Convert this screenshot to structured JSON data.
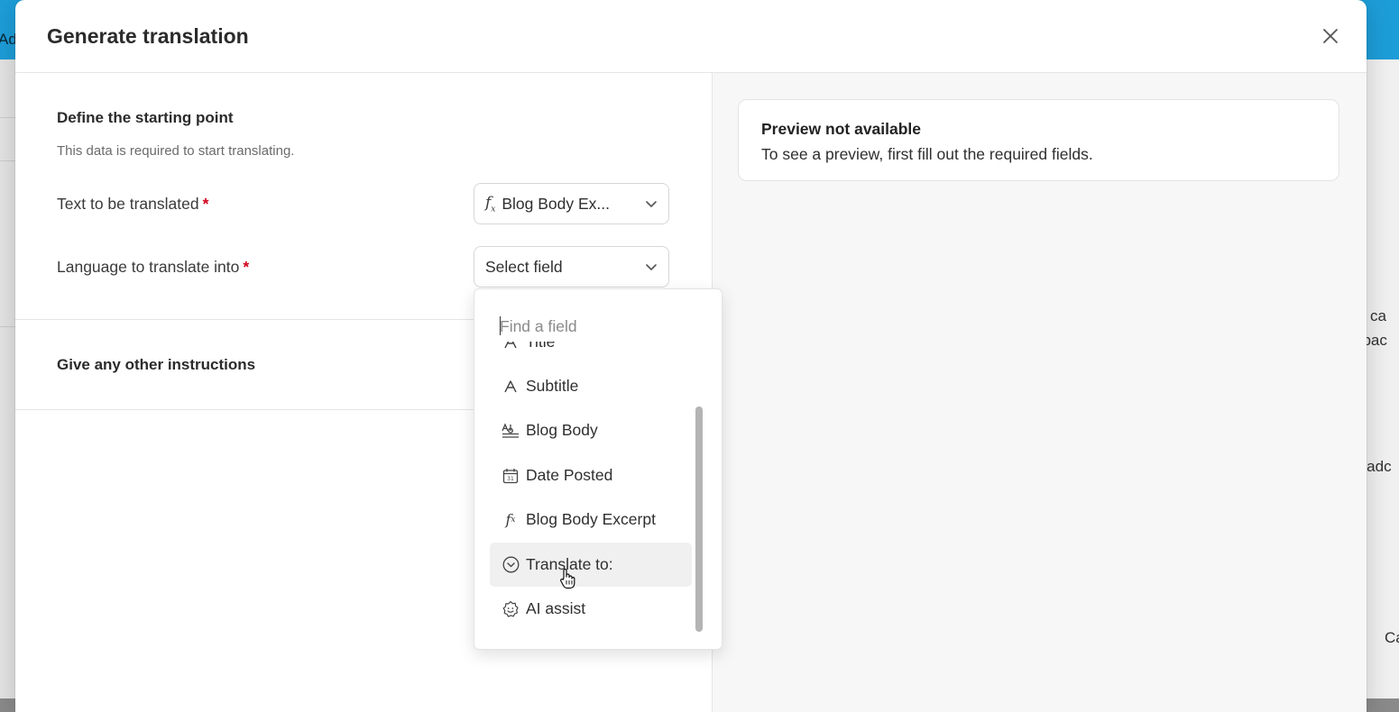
{
  "background": {
    "app_fragment": "Ad",
    "right_fragments": [
      "s, ca",
      "dbac",
      "n adc",
      "Ca"
    ]
  },
  "modal": {
    "title": "Generate translation",
    "close_icon": "close-icon"
  },
  "left": {
    "starting_point_title": "Define the starting point",
    "starting_point_subtitle": "This data is required to start translating.",
    "text_field_label": "Text to be translated",
    "text_field_value": "Blog Body Ex...",
    "text_field_icon": "formula-icon",
    "language_field_label": "Language to translate into",
    "language_field_value": "Select field",
    "required_mark": "*",
    "instructions_title": "Give any other instructions"
  },
  "preview": {
    "title": "Preview not available",
    "text": "To see a preview, first fill out the required fields."
  },
  "dropdown": {
    "search_placeholder": "Find a field",
    "options": [
      {
        "label": "Title",
        "icon": "single-line-text-icon"
      },
      {
        "label": "Subtitle",
        "icon": "single-line-text-icon"
      },
      {
        "label": "Blog Body",
        "icon": "long-text-icon"
      },
      {
        "label": "Date Posted",
        "icon": "calendar-icon"
      },
      {
        "label": "Blog Body Excerpt",
        "icon": "formula-icon"
      },
      {
        "label": "Translate to:",
        "icon": "single-select-icon"
      },
      {
        "label": "AI assist",
        "icon": "ai-assist-icon"
      }
    ],
    "hovered_option": "Translate to:"
  },
  "colors": {
    "required": "#d0021b",
    "topbar": "#1fa7e6",
    "hover": "#f0f0f0"
  }
}
